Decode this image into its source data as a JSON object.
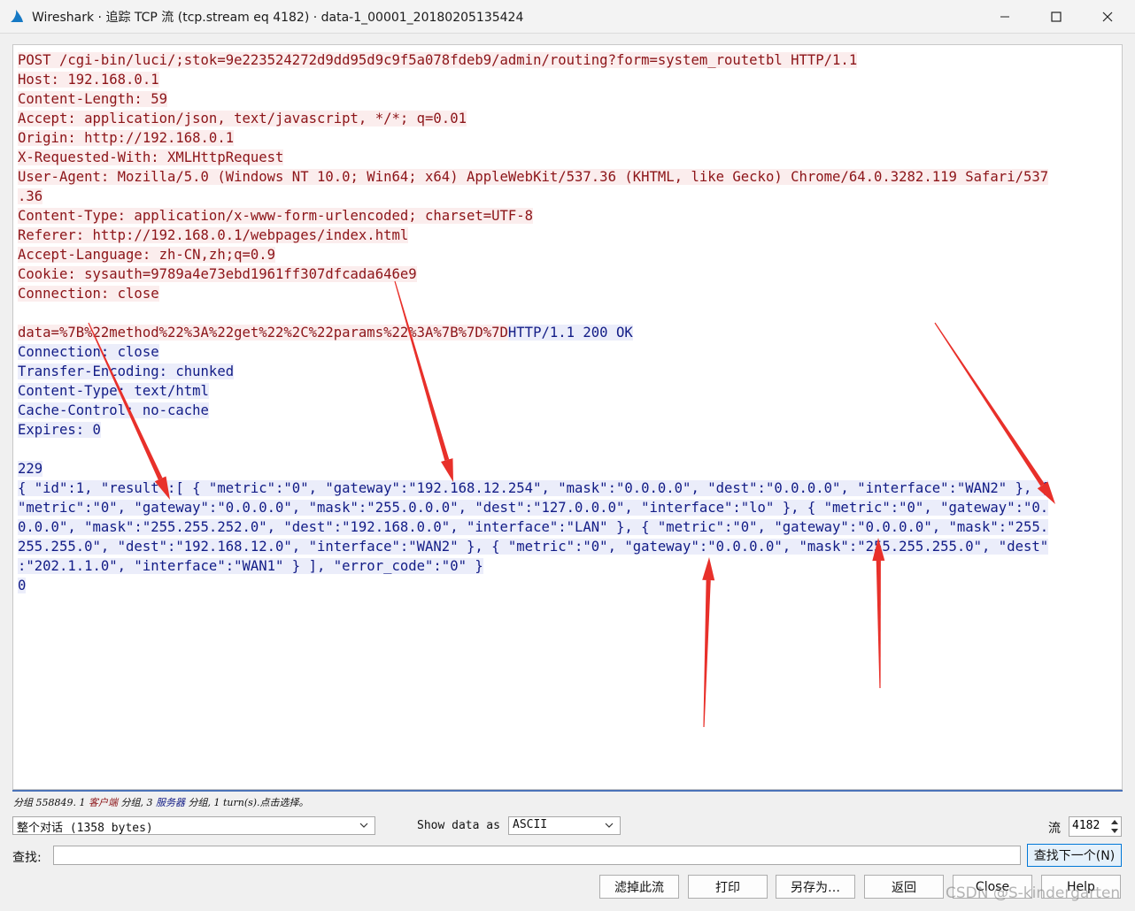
{
  "window": {
    "title": "Wireshark · 追踪 TCP 流 (tcp.stream eq 4182) · data-1_00001_20180205135424",
    "icon": "wireshark-fin-icon",
    "accent_color": "#1679c4"
  },
  "stream": {
    "client_color": "#8c1418",
    "client_bg": "#fbeded",
    "server_color": "#121c86",
    "server_bg": "#ebedfa",
    "lines": [
      {
        "segs": [
          {
            "t": "POST /cgi-bin/luci/;stok=9e223524272d9dd95d9c9f5a078fdeb9/admin/routing?form=system_routetbl HTTP/1.1",
            "c": "cl"
          }
        ]
      },
      {
        "segs": [
          {
            "t": "Host: 192.168.0.1",
            "c": "cl"
          }
        ]
      },
      {
        "segs": [
          {
            "t": "Content-Length: 59",
            "c": "cl"
          }
        ]
      },
      {
        "segs": [
          {
            "t": "Accept: application/json, text/javascript, */*; q=0.01",
            "c": "cl"
          }
        ]
      },
      {
        "segs": [
          {
            "t": "Origin: http://192.168.0.1",
            "c": "cl"
          }
        ]
      },
      {
        "segs": [
          {
            "t": "X-Requested-With: XMLHttpRequest",
            "c": "cl"
          }
        ]
      },
      {
        "segs": [
          {
            "t": "User-Agent: Mozilla/5.0 (Windows NT 10.0; Win64; x64) AppleWebKit/537.36 (KHTML, like Gecko) Chrome/64.0.3282.119 Safari/537",
            "c": "cl"
          }
        ]
      },
      {
        "segs": [
          {
            "t": ".36",
            "c": "cl"
          }
        ]
      },
      {
        "segs": [
          {
            "t": "Content-Type: application/x-www-form-urlencoded; charset=UTF-8",
            "c": "cl"
          }
        ]
      },
      {
        "segs": [
          {
            "t": "Referer: http://192.168.0.1/webpages/index.html",
            "c": "cl"
          }
        ]
      },
      {
        "segs": [
          {
            "t": "Accept-Language: zh-CN,zh;q=0.9",
            "c": "cl"
          }
        ]
      },
      {
        "segs": [
          {
            "t": "Cookie: sysauth=9789a4e73ebd1961ff307dfcada646e9",
            "c": "cl"
          }
        ]
      },
      {
        "segs": [
          {
            "t": "Connection: close",
            "c": "cl"
          }
        ]
      },
      {
        "segs": []
      },
      {
        "segs": [
          {
            "t": "data=%7B%22method%22%3A%22get%22%2C%22params%22%3A%7B%7D%7D",
            "c": "cl"
          },
          {
            "t": "HTTP/1.1 200 OK",
            "c": "sv"
          }
        ]
      },
      {
        "segs": [
          {
            "t": "Connection: close",
            "c": "sv"
          }
        ]
      },
      {
        "segs": [
          {
            "t": "Transfer-Encoding: chunked",
            "c": "sv"
          }
        ]
      },
      {
        "segs": [
          {
            "t": "Content-Type: text/html",
            "c": "sv"
          }
        ]
      },
      {
        "segs": [
          {
            "t": "Cache-Control: no-cache",
            "c": "sv"
          }
        ]
      },
      {
        "segs": [
          {
            "t": "Expires: 0",
            "c": "sv"
          }
        ]
      },
      {
        "segs": []
      },
      {
        "segs": [
          {
            "t": "229",
            "c": "sv"
          }
        ]
      },
      {
        "segs": [
          {
            "t": "{ \"id\":1, \"result\":[ { \"metric\":\"0\", \"gateway\":\"192.168.12.254\", \"mask\":\"0.0.0.0\", \"dest\":\"0.0.0.0\", \"interface\":\"WAN2\" }, {",
            "c": "sv"
          }
        ]
      },
      {
        "segs": [
          {
            "t": "\"metric\":\"0\", \"gateway\":\"0.0.0.0\", \"mask\":\"255.0.0.0\", \"dest\":\"127.0.0.0\", \"interface\":\"lo\" }, { \"metric\":\"0\", \"gateway\":\"0.",
            "c": "sv"
          }
        ]
      },
      {
        "segs": [
          {
            "t": "0.0.0\", \"mask\":\"255.255.252.0\", \"dest\":\"192.168.0.0\", \"interface\":\"LAN\" }, { \"metric\":\"0\", \"gateway\":\"0.0.0.0\", \"mask\":\"255.",
            "c": "sv"
          }
        ]
      },
      {
        "segs": [
          {
            "t": "255.255.0\", \"dest\":\"192.168.12.0\", \"interface\":\"WAN2\" }, { \"metric\":\"0\", \"gateway\":\"0.0.0.0\", \"mask\":\"255.255.255.0\", \"dest\"",
            "c": "sv"
          }
        ]
      },
      {
        "segs": [
          {
            "t": ":\"202.1.1.0\", \"interface\":\"WAN1\" } ], \"error_code\":\"0\" }",
            "c": "sv"
          }
        ]
      },
      {
        "segs": [
          {
            "t": "0",
            "c": "sv"
          }
        ]
      }
    ],
    "annotation_color": "#e8302a"
  },
  "status": {
    "p1": "分组 558849. 1 ",
    "client": "客户端",
    "p2": " 分组, 3 ",
    "server": "服务器",
    "p3": " 分组, 1 turn(s).点击选择。"
  },
  "controls": {
    "conversation_select": "整个对话 (1358 bytes)",
    "show_data_label": "Show data as",
    "show_data_select": "ASCII",
    "stream_label": "流",
    "stream_value": "4182",
    "find_label": "查找:",
    "find_value": "",
    "find_next": "查找下一个(N)"
  },
  "buttons": {
    "filter_out": "滤掉此流",
    "print": "打印",
    "save_as": "另存为…",
    "back": "返回",
    "close": "Close",
    "help": "Help"
  },
  "watermark": "CSDN @S-kindergarten"
}
